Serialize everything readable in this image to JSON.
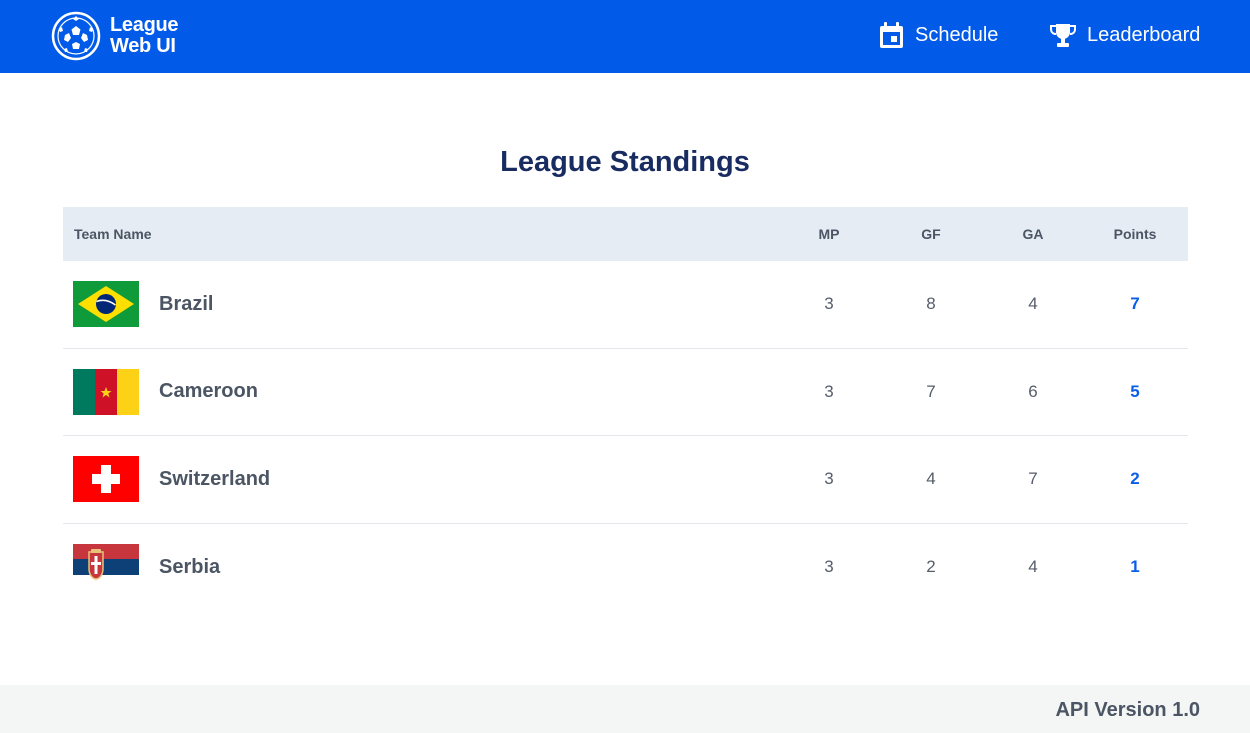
{
  "header": {
    "logo_line1": "League",
    "logo_line2": "Web UI",
    "nav": [
      {
        "label": "Schedule",
        "icon": "calendar-icon"
      },
      {
        "label": "Leaderboard",
        "icon": "trophy-icon"
      }
    ]
  },
  "page": {
    "title": "League Standings"
  },
  "table": {
    "columns": [
      "Team Name",
      "MP",
      "GF",
      "GA",
      "Points"
    ],
    "rows": [
      {
        "team": "Brazil",
        "flag": "brazil-flag-icon",
        "mp": "3",
        "gf": "8",
        "ga": "4",
        "points": "7"
      },
      {
        "team": "Cameroon",
        "flag": "cameroon-flag-icon",
        "mp": "3",
        "gf": "7",
        "ga": "6",
        "points": "5"
      },
      {
        "team": "Switzerland",
        "flag": "switzerland-flag-icon",
        "mp": "3",
        "gf": "4",
        "ga": "7",
        "points": "2"
      },
      {
        "team": "Serbia",
        "flag": "serbia-flag-icon",
        "mp": "3",
        "gf": "2",
        "ga": "4",
        "points": "1"
      }
    ]
  },
  "footer": {
    "api_version": "API Version 1.0"
  },
  "colors": {
    "header_bg": "#025ae8",
    "title": "#182c62",
    "points": "#0b5ee8",
    "table_header_bg": "#e5ecf4",
    "footer_bg": "#f4f5f5"
  }
}
